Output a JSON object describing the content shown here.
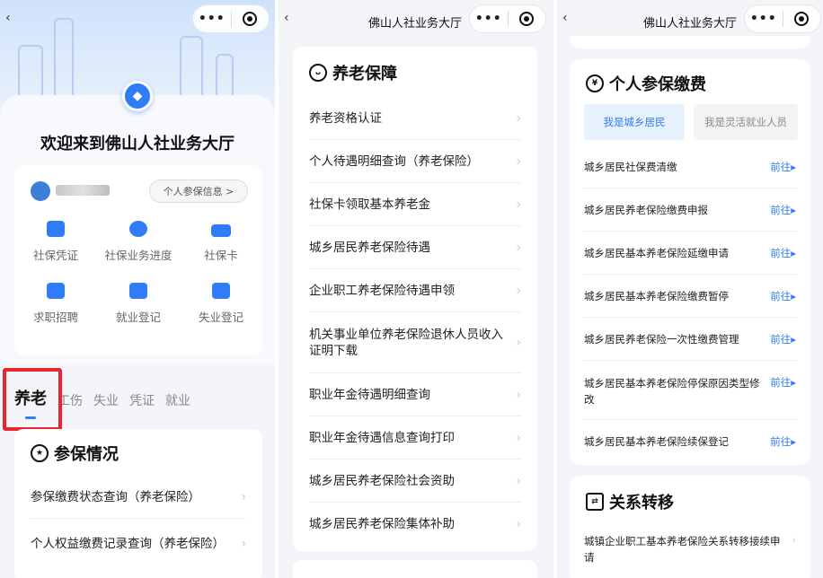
{
  "screen1": {
    "welcome_title": "欢迎来到佛山人社业务大厅",
    "info_button": "个人参保信息 >",
    "services": [
      {
        "label": "社保凭证",
        "icon": "certificate-icon"
      },
      {
        "label": "社保业务进度",
        "icon": "clock-icon"
      },
      {
        "label": "社保卡",
        "icon": "card-icon"
      },
      {
        "label": "求职招聘",
        "icon": "briefcase-icon"
      },
      {
        "label": "就业登记",
        "icon": "register-icon"
      },
      {
        "label": "失业登记",
        "icon": "unemployment-icon"
      }
    ],
    "tabs": [
      "养老",
      "工伤",
      "失业",
      "凭证",
      "就业"
    ],
    "active_tab": "养老",
    "section_title": "参保情况",
    "items": [
      "参保缴费状态查询（养老保险）",
      "个人权益缴费记录查询（养老保险）"
    ]
  },
  "screen2": {
    "nav_title": "佛山人社业务大厅",
    "section_title": "养老保障",
    "items": [
      "养老资格认证",
      "个人待遇明细查询（养老保险）",
      "社保卡领取基本养老金",
      "城乡居民养老保险待遇",
      "企业职工养老保险待遇申领",
      "机关事业单位养老保险退休人员收入证明下载",
      "职业年金待遇明细查询",
      "职业年金待遇信息查询打印",
      "城乡居民养老保险社会资助",
      "城乡居民养老保险集体补助"
    ]
  },
  "screen3": {
    "nav_title": "佛山人社业务大厅",
    "section_title": "个人参保缴费",
    "segments": [
      "我是城乡居民",
      "我是灵活就业人员"
    ],
    "go_label": "前往▸",
    "items": [
      "城乡居民社保费清缴",
      "城乡居民养老保险缴费申报",
      "城乡居民基本养老保险延缴申请",
      "城乡居民基本养老保险缴费暂停",
      "城乡居民养老保险一次性缴费管理",
      "城乡居民基本养老保险停保原因类型修改",
      "城乡居民基本养老保险续保登记"
    ],
    "section2_title": "关系转移",
    "section2_items": [
      "城镇企业职工基本养老保险关系转移接续申请"
    ]
  },
  "nav": {
    "back": "‹",
    "more": "•••"
  },
  "colors": {
    "accent": "#2f7cf6",
    "highlight": "#e8262b"
  }
}
